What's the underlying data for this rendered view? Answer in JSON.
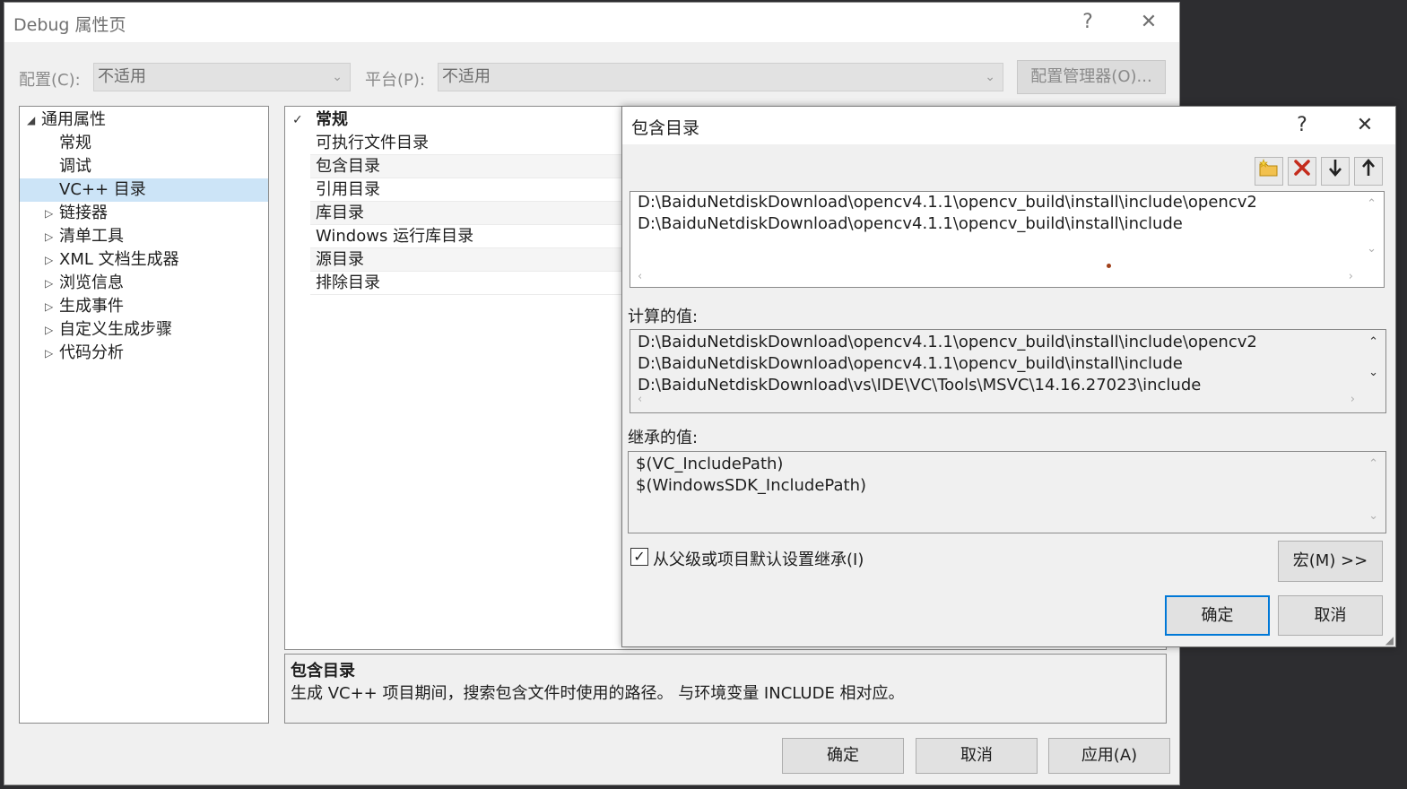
{
  "window": {
    "title": "Debug 属性页",
    "help_glyph": "?",
    "close_glyph": "✕"
  },
  "config_bar": {
    "config_label": "配置(C):",
    "config_value": "不适用",
    "platform_label": "平台(P):",
    "platform_value": "不适用",
    "manager_button": "配置管理器(O)..."
  },
  "tree": {
    "root": "通用属性",
    "items": [
      {
        "label": "常规",
        "expandable": false
      },
      {
        "label": "调试",
        "expandable": false
      },
      {
        "label": "VC++ 目录",
        "expandable": false,
        "selected": true
      },
      {
        "label": "链接器",
        "expandable": true
      },
      {
        "label": "清单工具",
        "expandable": true
      },
      {
        "label": "XML 文档生成器",
        "expandable": true
      },
      {
        "label": "浏览信息",
        "expandable": true
      },
      {
        "label": "生成事件",
        "expandable": true
      },
      {
        "label": "自定义生成步骤",
        "expandable": true
      },
      {
        "label": "代码分析",
        "expandable": true
      }
    ]
  },
  "grid": {
    "category": "常规",
    "rows": [
      "可执行文件目录",
      "包含目录",
      "引用目录",
      "库目录",
      "Windows 运行库目录",
      "源目录",
      "排除目录"
    ]
  },
  "description": {
    "title": "包含目录",
    "text": "生成 VC++ 项目期间，搜索包含文件时使用的路径。 与环境变量 INCLUDE 相对应。"
  },
  "footer": {
    "ok": "确定",
    "cancel": "取消",
    "apply": "应用(A)"
  },
  "dialog": {
    "title": "包含目录",
    "help_glyph": "?",
    "close_glyph": "✕",
    "toolbar_icons": [
      "new-folder-icon",
      "delete-icon",
      "move-down-icon",
      "move-up-icon"
    ],
    "entries": [
      "D:\\BaiduNetdiskDownload\\opencv4.1.1\\opencv_build\\install\\include\\opencv2",
      "D:\\BaiduNetdiskDownload\\opencv4.1.1\\opencv_build\\install\\include"
    ],
    "evaluated_label": "计算的值:",
    "evaluated": [
      "D:\\BaiduNetdiskDownload\\opencv4.1.1\\opencv_build\\install\\include\\opencv2",
      "D:\\BaiduNetdiskDownload\\opencv4.1.1\\opencv_build\\install\\include",
      "D:\\BaiduNetdiskDownload\\vs\\IDE\\VC\\Tools\\MSVC\\14.16.27023\\include"
    ],
    "inherited_label": "继承的值:",
    "inherited": [
      "$(VC_IncludePath)",
      "$(WindowsSDK_IncludePath)"
    ],
    "inherit_checkbox": "从父级或项目默认设置继承(I)",
    "inherit_checked": true,
    "macros_button": "宏(M) >>",
    "ok": "确定",
    "cancel": "取消"
  },
  "colors": {
    "selection": "#cce4f7",
    "accent": "#0078d7"
  }
}
